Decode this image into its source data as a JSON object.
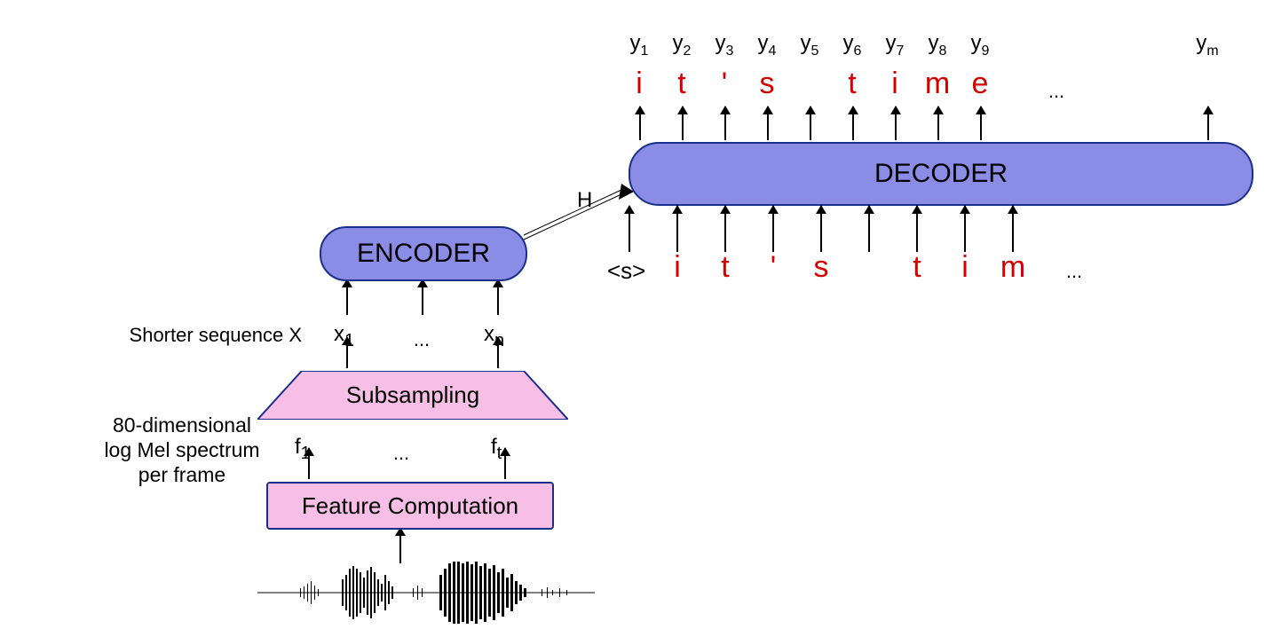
{
  "labels": {
    "shorterSeq": "Shorter sequence X",
    "melSpectrum_l1": "80-dimensional",
    "melSpectrum_l2": "log Mel spectrum",
    "melSpectrum_l3": "per frame",
    "featureComputation": "Feature Computation",
    "subsampling": "Subsampling",
    "encoder": "ENCODER",
    "decoder": "DECODER",
    "H": "H",
    "startToken": "<s>",
    "ellipsis": "…",
    "ellipsis3": "..."
  },
  "x_inputs": {
    "first": "x",
    "firstSub": "1",
    "last": "x",
    "lastSub": "n"
  },
  "f_inputs": {
    "first": "f",
    "firstSub": "1",
    "last": "f",
    "lastSub": "t"
  },
  "y_outputs": [
    {
      "base": "y",
      "sub": "1"
    },
    {
      "base": "y",
      "sub": "2"
    },
    {
      "base": "y",
      "sub": "3"
    },
    {
      "base": "y",
      "sub": "4"
    },
    {
      "base": "y",
      "sub": "5"
    },
    {
      "base": "y",
      "sub": "6"
    },
    {
      "base": "y",
      "sub": "7"
    },
    {
      "base": "y",
      "sub": "8"
    },
    {
      "base": "y",
      "sub": "9"
    },
    {
      "base": "y",
      "sub": "m"
    }
  ],
  "out_chars": [
    "i",
    "t",
    "'",
    "s",
    "",
    "t",
    "i",
    "m",
    "e"
  ],
  "in_chars": [
    "i",
    "t",
    "'",
    "s",
    "",
    "t",
    "i",
    "m"
  ]
}
